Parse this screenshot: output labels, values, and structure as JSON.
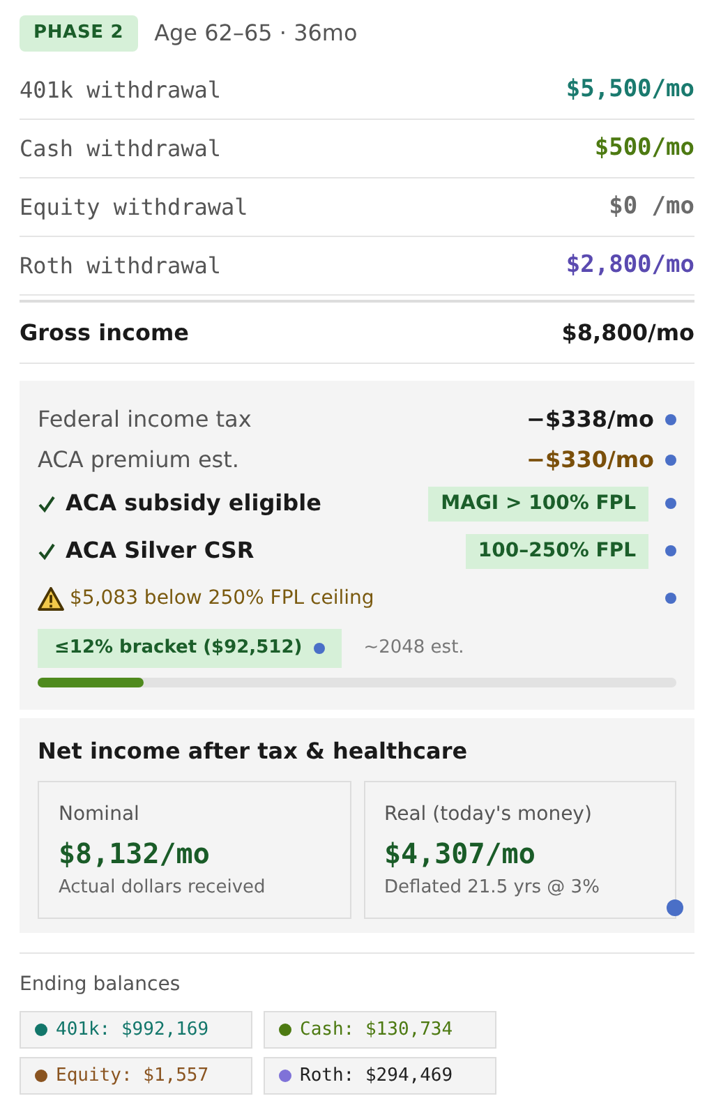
{
  "phase": {
    "badge": "PHASE 2",
    "subtitle": "Age 62–65 · 36mo"
  },
  "withdrawals": [
    {
      "label": "401k withdrawal",
      "amount": "$5,500/mo",
      "color": "#1a7a6e"
    },
    {
      "label": "Cash withdrawal",
      "amount": "$500/mo",
      "color": "#4d7a12"
    },
    {
      "label": "Equity withdrawal",
      "amount": "$0 /mo",
      "color": "#6b6b6b"
    },
    {
      "label": "Roth withdrawal",
      "amount": "$2,800/mo",
      "color": "#5a4ab0"
    }
  ],
  "gross": {
    "label": "Gross income",
    "amount": "$8,800/mo"
  },
  "tax_panel": {
    "rows": [
      {
        "kind": "cost",
        "label": "Federal income tax",
        "value": "−$338/mo",
        "color": "#1a1a1a"
      },
      {
        "kind": "cost",
        "label": "ACA premium est.",
        "value": "−$330/mo",
        "color": "#7a4f0a"
      },
      {
        "kind": "check",
        "checked": true,
        "label": "ACA subsidy eligible",
        "value": "MAGI > 100% FPL"
      },
      {
        "kind": "check",
        "checked": true,
        "label": "ACA Silver CSR",
        "value": "100–250% FPL"
      },
      {
        "kind": "warning",
        "label": "$5,083 below 250% FPL ceiling"
      }
    ],
    "bracket": {
      "label": "≤12% bracket ($92,512)",
      "note": "~2048 est.",
      "level": 0.165
    }
  },
  "net": {
    "title": "Net income after tax & healthcare",
    "cards": [
      {
        "label": "Nominal",
        "value": "$8,132/mo",
        "note": "Actual dollars received"
      },
      {
        "label": "Real (today's money)",
        "value": "$4,307/mo",
        "note": "Deflated 21.5 yrs @ 3%"
      }
    ]
  },
  "balances": {
    "title": "Ending balances",
    "items": [
      {
        "kind": "tinted",
        "text": "401k: $992,169",
        "color": "#12766a"
      },
      {
        "kind": "tinted",
        "text": "Cash: $130,734",
        "color": "#4d7a12"
      },
      {
        "kind": "tinted",
        "text": "Equity: $1,557",
        "color": "#8a5420"
      },
      {
        "kind": "plain",
        "text": "Roth: $294,469",
        "color": "#7f72d8"
      }
    ]
  }
}
